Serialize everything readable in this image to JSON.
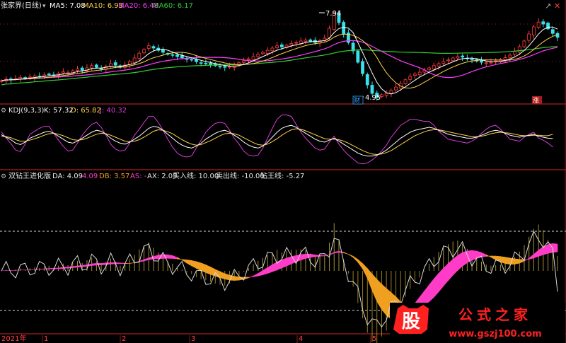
{
  "colors": {
    "background": "#000000",
    "frame": "#8b1a1a",
    "up": "#ff3b3b",
    "down": "#38e0e8",
    "ma5": "#ffffff",
    "ma10": "#ffd24a",
    "ma20": "#ff3cff",
    "ma60": "#33cc33",
    "kdj_k": "#ffffff",
    "kdj_d": "#ffd24a",
    "kdj_j": "#d63cd6",
    "da_band": "#ff3cc8",
    "db_band": "#f0a020",
    "zt_line": "#d8d8d8",
    "watermark_red": "#ff2020"
  },
  "header_main": {
    "title": "张家界(日线)",
    "ma5": "MA5: 7.08",
    "ma10": "MA10: 6.93",
    "ma20": "MA20: 6.48",
    "ma60": "MA60: 6.17"
  },
  "header_kdj": {
    "name": "KDJ(9,3,3)",
    "k": "K: 57.32",
    "d": "D: 65.82",
    "j": "J: 40.32"
  },
  "header_ind": {
    "name": "双钻王进化版",
    "da": "DA: 4.09",
    "da2": "4.09",
    "db": "DB: 3.57",
    "as": "AS: -",
    "ax": "AX: 2.05",
    "buy": "买入线: 10.00",
    "sell": "卖出线: -10.00",
    "zt": "钻王线: -5.27"
  },
  "annotations": {
    "high": "7.94",
    "low": "4.95",
    "tag_cai": "财",
    "tag_zhang": "涨"
  },
  "xaxis": {
    "year": "2021年",
    "months": [
      "1",
      "2",
      "3",
      "4",
      "5"
    ]
  },
  "watermark": {
    "logo_char": "股",
    "text": "公式之家",
    "url": "www.gszj100.com"
  },
  "chart_data": {
    "type": "line",
    "price_high": 7.94,
    "price_low": 4.95,
    "ma_last": {
      "MA5": 7.08,
      "MA10": 6.93,
      "MA20": 6.48,
      "MA60": 6.17
    },
    "kdj_last": {
      "K": 57.32,
      "D": 65.82,
      "J": 40.32
    },
    "indicator_last": {
      "DA": 4.09,
      "DB": 3.57,
      "AX": 2.05,
      "buy_line": 10.0,
      "sell_line": -10.0,
      "zuanwang_line": -5.27
    },
    "closes": [
      5.55,
      5.6,
      5.58,
      5.62,
      5.66,
      5.63,
      5.68,
      5.72,
      5.7,
      5.75,
      5.78,
      5.74,
      5.8,
      5.86,
      5.83,
      5.9,
      5.96,
      5.92,
      6.0,
      6.08,
      6.02,
      5.96,
      6.05,
      6.15,
      6.1,
      6.02,
      6.1,
      6.22,
      6.35,
      6.52,
      6.65,
      6.78,
      6.7,
      6.62,
      6.55,
      6.48,
      6.45,
      6.4,
      6.36,
      6.3,
      6.28,
      6.22,
      6.18,
      6.15,
      6.12,
      6.08,
      6.05,
      6.02,
      6.05,
      6.1,
      6.18,
      6.25,
      6.32,
      6.4,
      6.48,
      6.55,
      6.62,
      6.7,
      6.78,
      6.74,
      6.8,
      6.86,
      6.9,
      6.95,
      6.98,
      6.94,
      6.9,
      6.96,
      7.05,
      7.4,
      7.94,
      7.6,
      7.2,
      6.9,
      6.6,
      6.2,
      5.8,
      5.4,
      5.1,
      4.95,
      5.05,
      5.1,
      5.2,
      5.32,
      5.45,
      5.58,
      5.7,
      5.78,
      5.85,
      5.92,
      6.0,
      6.08,
      6.15,
      6.22,
      6.28,
      6.35,
      6.4,
      6.38,
      6.32,
      6.28,
      6.24,
      6.2,
      6.18,
      6.2,
      6.25,
      6.3,
      6.36,
      6.45,
      6.58,
      6.75,
      6.95,
      7.2,
      7.45,
      7.62,
      7.55,
      7.38,
      7.22,
      7.08
    ],
    "kdj_k_series": [
      65,
      60,
      55,
      48,
      45,
      50,
      58,
      62,
      66,
      70,
      72,
      68,
      62,
      56,
      50,
      48,
      52,
      58,
      64,
      70,
      74,
      72,
      66,
      58,
      52,
      48,
      46,
      50,
      56,
      62,
      70,
      78,
      82,
      80,
      74,
      66,
      58,
      50,
      44,
      40,
      38,
      42,
      48,
      56,
      62,
      68,
      72,
      74,
      70,
      64,
      58,
      50,
      44,
      40,
      38,
      42,
      50,
      60,
      70,
      78,
      82,
      84,
      80,
      74,
      68,
      62,
      56,
      52,
      50,
      54,
      58,
      52,
      46,
      40,
      34,
      28,
      24,
      22,
      22,
      24,
      28,
      34,
      42,
      50,
      58,
      64,
      70,
      74,
      76,
      78,
      80,
      78,
      74,
      70,
      66,
      64,
      62,
      60,
      58,
      58,
      60,
      64,
      68,
      72,
      74,
      72,
      68,
      64,
      62,
      60,
      62,
      64,
      66,
      62,
      60,
      58,
      57.32
    ],
    "kdj_d_series": [
      62,
      61,
      59,
      55,
      52,
      52,
      54,
      57,
      60,
      64,
      67,
      68,
      66,
      63,
      59,
      55,
      54,
      55,
      58,
      62,
      66,
      68,
      67,
      64,
      60,
      56,
      52,
      51,
      52,
      55,
      60,
      66,
      72,
      75,
      74,
      71,
      67,
      61,
      55,
      50,
      46,
      44,
      45,
      49,
      53,
      58,
      63,
      67,
      68,
      67,
      64,
      59,
      54,
      49,
      45,
      44,
      46,
      51,
      57,
      64,
      70,
      75,
      77,
      76,
      73,
      69,
      65,
      61,
      57,
      56,
      56,
      55,
      52,
      48,
      43,
      38,
      33,
      29,
      26,
      25,
      26,
      29,
      33,
      39,
      45,
      51,
      57,
      63,
      67,
      71,
      74,
      75,
      75,
      73,
      71,
      69,
      67,
      65,
      63,
      61,
      61,
      62,
      64,
      67,
      69,
      70,
      69,
      68,
      66,
      64,
      63,
      63,
      64,
      64,
      63,
      63,
      65.82
    ]
  }
}
